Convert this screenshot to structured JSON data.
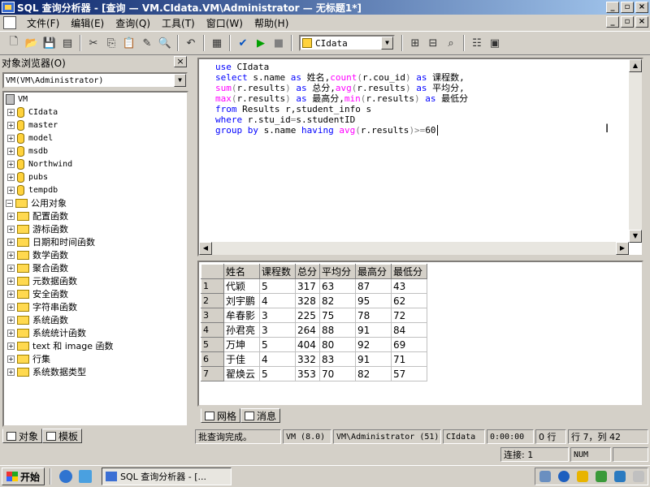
{
  "window": {
    "title": "SQL 查询分析器 - [查询 — VM.CIdata.VM\\Administrator — 无标题1*]"
  },
  "menu": [
    "文件(F)",
    "编辑(E)",
    "查询(Q)",
    "工具(T)",
    "窗口(W)",
    "帮助(H)"
  ],
  "toolbar": {
    "database": "CIdata"
  },
  "object_browser": {
    "title": "对象浏览器(O)",
    "connection": "VM(VM\\Administrator)",
    "server": "VM",
    "databases": [
      "CIdata",
      "master",
      "model",
      "msdb",
      "Northwind",
      "pubs",
      "tempdb"
    ],
    "common_objects_label": "公用对象",
    "common_objects": [
      "配置函数",
      "游标函数",
      "日期和时间函数",
      "数学函数",
      "聚合函数",
      "元数据函数",
      "安全函数",
      "字符串函数",
      "系统函数",
      "系统统计函数",
      "text 和 image 函数",
      "行集",
      "系统数据类型"
    ],
    "tabs": [
      "对象",
      "模板"
    ]
  },
  "editor": {
    "lines": [
      [
        [
          "kw",
          "use "
        ],
        [
          "tx",
          "CIdata"
        ]
      ],
      [
        [
          "kw",
          "select "
        ],
        [
          "tx",
          "s.name "
        ],
        [
          "kw",
          "as "
        ],
        [
          "tx",
          "姓名,"
        ],
        [
          "fn",
          "count"
        ],
        [
          "op",
          "("
        ],
        [
          "tx",
          "r.cou_id"
        ],
        [
          "op",
          ")"
        ],
        [
          "kw",
          " as "
        ],
        [
          "tx",
          "课程数,"
        ]
      ],
      [
        [
          "fn",
          "sum"
        ],
        [
          "op",
          "("
        ],
        [
          "tx",
          "r.results"
        ],
        [
          "op",
          ")"
        ],
        [
          "kw",
          " as "
        ],
        [
          "tx",
          "总分,"
        ],
        [
          "fn",
          "avg"
        ],
        [
          "op",
          "("
        ],
        [
          "tx",
          "r.results"
        ],
        [
          "op",
          ")"
        ],
        [
          "kw",
          " as "
        ],
        [
          "tx",
          "平均分,"
        ]
      ],
      [
        [
          "fn",
          "max"
        ],
        [
          "op",
          "("
        ],
        [
          "tx",
          "r.results"
        ],
        [
          "op",
          ")"
        ],
        [
          "kw",
          " as "
        ],
        [
          "tx",
          "最高分,"
        ],
        [
          "fn",
          "min"
        ],
        [
          "op",
          "("
        ],
        [
          "tx",
          "r.results"
        ],
        [
          "op",
          ")"
        ],
        [
          "kw",
          " as "
        ],
        [
          "tx",
          "最低分"
        ]
      ],
      [
        [
          "kw",
          "from "
        ],
        [
          "tx",
          "Results r,student_info s"
        ]
      ],
      [
        [
          "kw",
          "where "
        ],
        [
          "tx",
          "r.stu_id"
        ],
        [
          "op",
          "="
        ],
        [
          "tx",
          "s.studentID"
        ]
      ],
      [
        [
          "kw",
          "group by "
        ],
        [
          "tx",
          "s.name "
        ],
        [
          "kw",
          "having "
        ],
        [
          "fn",
          "avg"
        ],
        [
          "op",
          "("
        ],
        [
          "tx",
          "r.results"
        ],
        [
          "op",
          ")>="
        ],
        [
          "tx",
          "60"
        ]
      ]
    ]
  },
  "results": {
    "columns": [
      "姓名",
      "课程数",
      "总分",
      "平均分",
      "最高分",
      "最低分"
    ],
    "rows": [
      [
        "1",
        "代颖",
        "5",
        "317",
        "63",
        "87",
        "43"
      ],
      [
        "2",
        "刘宇鹏",
        "4",
        "328",
        "82",
        "95",
        "62"
      ],
      [
        "3",
        "牟春影",
        "3",
        "225",
        "75",
        "78",
        "72"
      ],
      [
        "4",
        "孙君亮",
        "3",
        "264",
        "88",
        "91",
        "84"
      ],
      [
        "5",
        "万坤",
        "5",
        "404",
        "80",
        "92",
        "69"
      ],
      [
        "6",
        "于佳",
        "4",
        "332",
        "83",
        "91",
        "71"
      ],
      [
        "7",
        "翟焕云",
        "5",
        "353",
        "70",
        "82",
        "57"
      ]
    ],
    "tabs": [
      "网格",
      "消息"
    ]
  },
  "query_status": {
    "message": "批查询完成。",
    "server": "VM (8.0)",
    "user": "VM\\Administrator (51)",
    "database": "CIdata",
    "elapsed": "0:00:00",
    "rows": "0 行",
    "position": "行 7，列 42"
  },
  "app_status": {
    "connections": "连接: 1",
    "num": "NUM"
  },
  "taskbar": {
    "start": "开始",
    "task": "SQL 查询分析器 - [..."
  }
}
